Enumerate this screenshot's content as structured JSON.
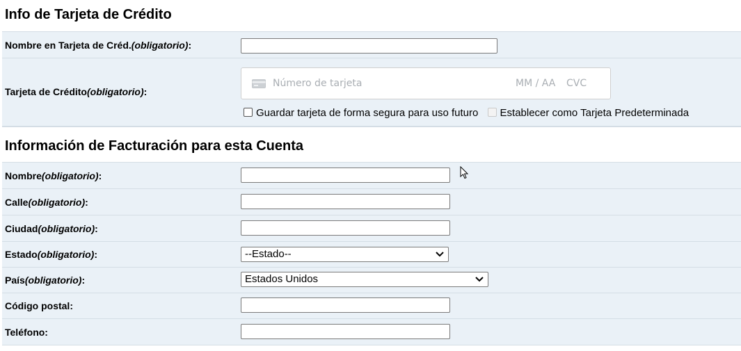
{
  "credit_card": {
    "title": "Info de Tarjeta de Crédito",
    "name_label": "Nombre en Tarjeta de Créd.",
    "card_label": "Tarjeta de Crédito",
    "required": "(obligatorio)",
    "card_placeholder": "Número de tarjeta",
    "expiry_placeholder": "MM / AA",
    "cvc_placeholder": "CVC",
    "save_card_label": "Guardar tarjeta de forma segura para uso futuro",
    "default_card_label": "Establecer como Tarjeta Predeterminada"
  },
  "billing": {
    "title": "Información de Facturación para esta Cuenta",
    "required": "(obligatorio)",
    "name_label": "Nombre",
    "street_label": "Calle",
    "city_label": "Ciudad",
    "state_label": "Estado",
    "state_value": "--Estado--",
    "country_label": "País",
    "country_value": "Estados Unidos",
    "postal_label": "Código postal",
    "phone_label": "Teléfono"
  },
  "colors": {
    "row_bg": "#eaf1f7",
    "row_border": "#d4dde5",
    "placeholder": "#a9aeb3"
  }
}
